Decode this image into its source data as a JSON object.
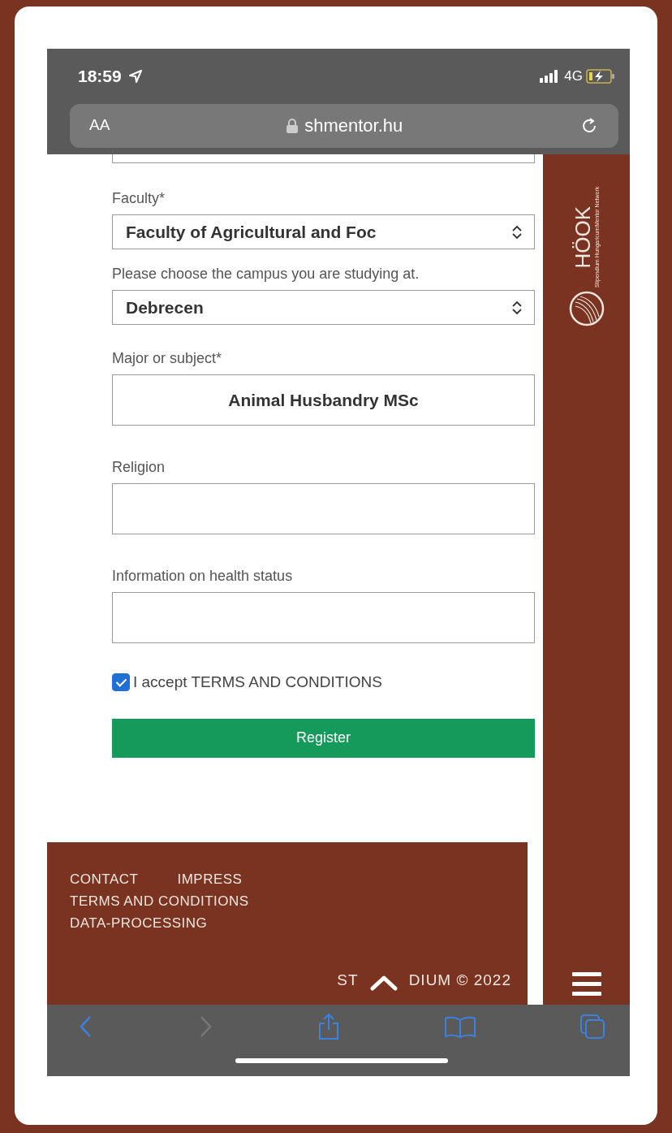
{
  "status_bar": {
    "time": "18:59",
    "network": "4G"
  },
  "address_bar": {
    "text_size": "AA",
    "url": "shmentor.hu"
  },
  "form": {
    "fields": [
      {
        "kind": "select",
        "label": "Faculty*",
        "value": "Faculty of Agricultural and Foc"
      },
      {
        "kind": "select",
        "label": "Please choose the campus you are studying at.",
        "value": "Debrecen"
      },
      {
        "kind": "input",
        "label": "Major or subject*",
        "value": "Animal Husbandry MSc"
      },
      {
        "kind": "input",
        "label": "Religion"
      },
      {
        "kind": "input",
        "label": "Information on health status"
      }
    ],
    "terms": {
      "label": "I accept TERMS AND CONDITIONS",
      "checked": true
    },
    "submit": "Register"
  },
  "footer": {
    "links": [
      "CONTACT",
      "IMPRESS",
      "TERMS AND CONDITIONS",
      "DATA-PROCESSING"
    ],
    "copyright_start": "ST",
    "copyright_end": "DIUM © 2022"
  },
  "sidebar": {
    "logo": "HÖOK",
    "logo_subtitle": [
      "Stipendium Hungaricum",
      "Mentor Network"
    ]
  }
}
